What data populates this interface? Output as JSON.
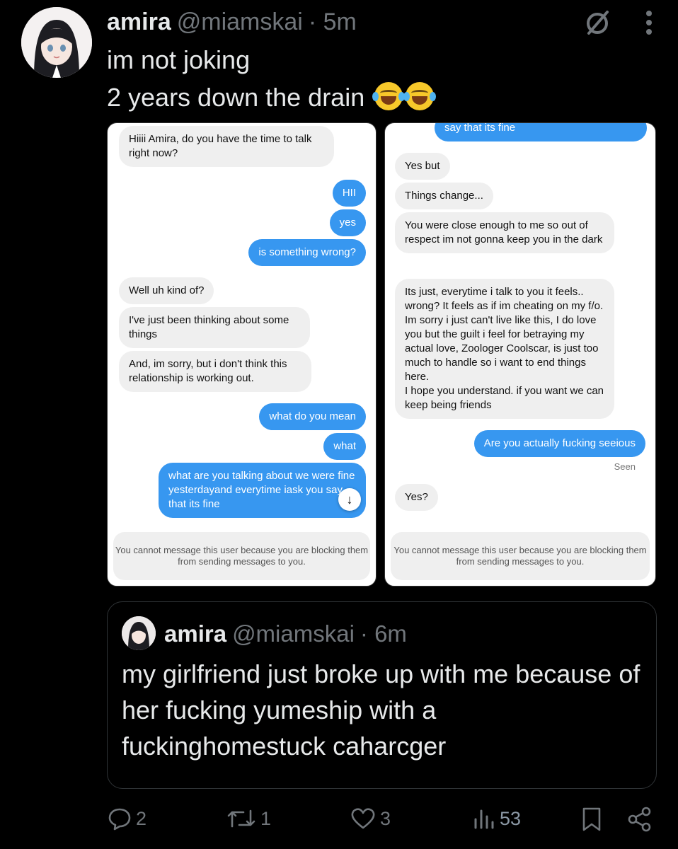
{
  "tweet": {
    "display_name": "amira",
    "handle": "@miamskai",
    "time": "· 5m",
    "line1": "im not joking",
    "line2": "2 years down the drain"
  },
  "left_chat": {
    "messages": [
      {
        "dir": "in",
        "text": "Hiiii Amira, do you have the time to talk right now?"
      },
      {
        "dir": "out",
        "text": "HII"
      },
      {
        "dir": "out",
        "text": "yes"
      },
      {
        "dir": "out",
        "text": "is something wrong?"
      },
      {
        "dir": "in",
        "text": "Well uh kind of?"
      },
      {
        "dir": "in",
        "text": "I've just been thinking about some things"
      },
      {
        "dir": "in",
        "text": "And, im sorry, but i don't think this relationship is working out."
      },
      {
        "dir": "out",
        "text": "what do you mean"
      },
      {
        "dir": "out",
        "text": "what"
      },
      {
        "dir": "out",
        "text": "what are you talking about we were fine yesterdayand everytime iask you say that its fine"
      }
    ],
    "blocked_notice": "You cannot message this user because you are blocking them from sending messages to you."
  },
  "right_chat": {
    "messages": [
      {
        "dir": "out",
        "text": "say that its fine"
      },
      {
        "dir": "in",
        "text": "Yes but"
      },
      {
        "dir": "in",
        "text": "Things change..."
      },
      {
        "dir": "in",
        "text": "You were close enough to me so out of respect im not gonna keep you in the dark"
      },
      {
        "dir": "in",
        "text": "Its just, everytime i talk to you it feels.. wrong? It feels as if im cheating on my f/o. Im sorry i just can't live like this, I do love you but the guilt i feel for betraying my actual love, Zoologer Coolscar, is just too much to handle so i want to end things here.\nI hope you understand. if you want we can keep being friends"
      },
      {
        "dir": "out",
        "text": "Are you actually fucking seeious"
      },
      {
        "dir": "in",
        "text": "Yes?"
      }
    ],
    "seen_label": "Seen",
    "blocked_notice": "You cannot message this user because you are blocking them from sending messages to you."
  },
  "quote": {
    "display_name": "amira",
    "handle": "@miamskai",
    "time": "· 6m",
    "text": "my girlfriend just broke up with me because of her fucking yumeship with a fuckinghomestuck caharcger"
  },
  "actions": {
    "replies": "2",
    "reposts": "1",
    "likes": "3",
    "views": "53"
  },
  "colors": {
    "background": "#000000",
    "muted": "#71767b",
    "outgoing_bubble": "#3797f0",
    "incoming_bubble": "#efefef"
  }
}
